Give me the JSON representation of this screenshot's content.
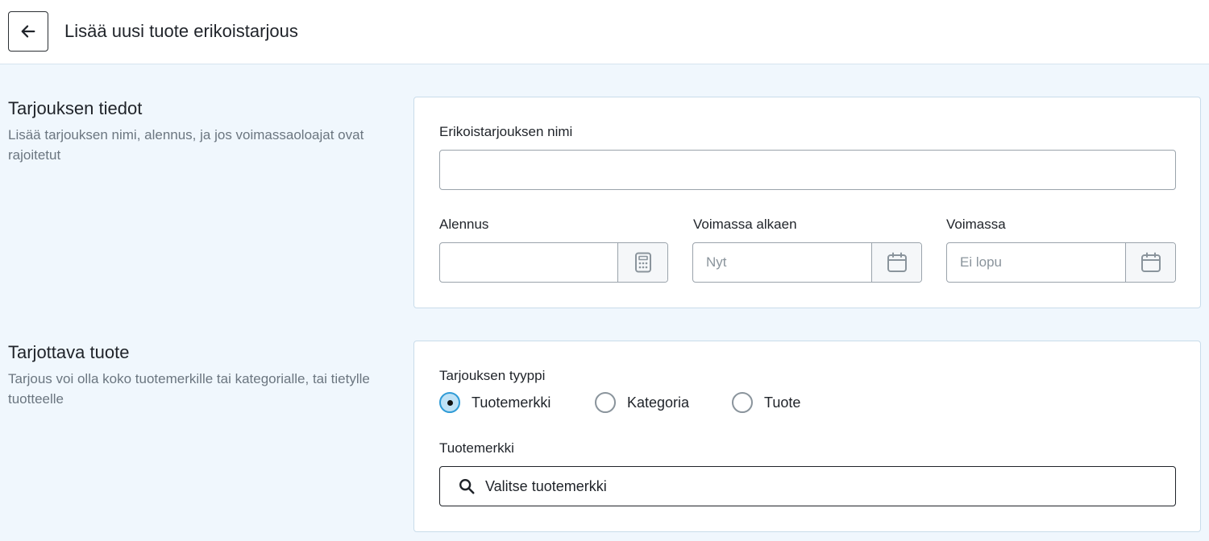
{
  "header": {
    "title": "Lisää uusi tuote erikoistarjous"
  },
  "section_offer": {
    "title": "Tarjouksen tiedot",
    "description": "Lisää tarjouksen nimi, alennus, ja jos voimassaoloajat ovat rajoitetut",
    "name_label": "Erikoistarjouksen nimi",
    "name_value": "",
    "discount_label": "Alennus",
    "discount_value": "",
    "valid_from_label": "Voimassa alkaen",
    "valid_from_placeholder": "Nyt",
    "valid_until_label": "Voimassa",
    "valid_until_placeholder": "Ei lopu"
  },
  "section_product": {
    "title": "Tarjottava tuote",
    "description": "Tarjous voi olla koko tuotemerkille tai kategorialle, tai tietylle tuotteelle",
    "type_label": "Tarjouksen tyyppi",
    "types": [
      {
        "label": "Tuotemerkki",
        "checked": true
      },
      {
        "label": "Kategoria",
        "checked": false
      },
      {
        "label": "Tuote",
        "checked": false
      }
    ],
    "brand_label": "Tuotemerkki",
    "brand_search_text": "Valitse tuotemerkki"
  },
  "icons": {
    "back": "arrow-left-icon",
    "discount": "calculator-icon",
    "date": "calendar-icon",
    "search": "search-icon"
  },
  "colors": {
    "background": "#f0f7fd",
    "radio_checked": "#bfe2f6",
    "radio_checked_border": "#2f9bd6"
  }
}
